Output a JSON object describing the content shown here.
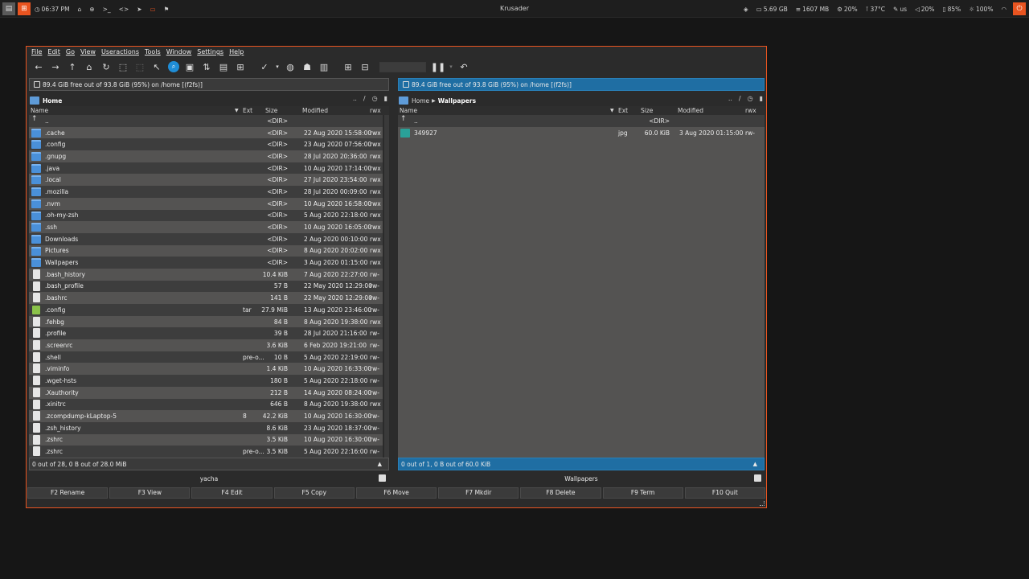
{
  "topbar": {
    "time": "06:37 PM",
    "title": "Krusader",
    "disk": "5.69 GB",
    "mem": "1607 MB",
    "cpu": "20%",
    "temp": "37°C",
    "kbd": "us",
    "volume": "20%",
    "battery": "85%",
    "brightness": "100%"
  },
  "menu": [
    "File",
    "Edit",
    "Go",
    "View",
    "Useractions",
    "Tools",
    "Window",
    "Settings",
    "Help"
  ],
  "left": {
    "info": "89.4 GiB free out of 93.8 GiB (95%) on /home [(f2fs)]",
    "path": {
      "folder": "Home",
      "crumbs": []
    },
    "controls": [
      "..",
      "/"
    ],
    "headers": {
      "name": "Name",
      "ext": "Ext",
      "size": "Size",
      "modified": "Modified",
      "perm": "rwx"
    },
    "rows": [
      {
        "icon": "up",
        "name": "..",
        "ext": "",
        "size": "<DIR>",
        "modified": "",
        "perm": ""
      },
      {
        "icon": "dir",
        "name": ".cache",
        "ext": "",
        "size": "<DIR>",
        "modified": "22 Aug 2020 15:58:00",
        "perm": "rwx"
      },
      {
        "icon": "dir",
        "name": ".config",
        "ext": "",
        "size": "<DIR>",
        "modified": "23 Aug 2020 07:56:00",
        "perm": "rwx"
      },
      {
        "icon": "dir",
        "name": ".gnupg",
        "ext": "",
        "size": "<DIR>",
        "modified": "28 Jul 2020 20:36:00",
        "perm": "rwx"
      },
      {
        "icon": "dir",
        "name": ".java",
        "ext": "",
        "size": "<DIR>",
        "modified": "10 Aug 2020 17:14:00",
        "perm": "rwx"
      },
      {
        "icon": "dir",
        "name": ".local",
        "ext": "",
        "size": "<DIR>",
        "modified": "27 Jul 2020 23:54:00",
        "perm": "rwx"
      },
      {
        "icon": "dir",
        "name": ".mozilla",
        "ext": "",
        "size": "<DIR>",
        "modified": "28 Jul 2020 00:09:00",
        "perm": "rwx"
      },
      {
        "icon": "dir",
        "name": ".nvm",
        "ext": "",
        "size": "<DIR>",
        "modified": "10 Aug 2020 16:58:00",
        "perm": "rwx"
      },
      {
        "icon": "dir",
        "name": ".oh-my-zsh",
        "ext": "",
        "size": "<DIR>",
        "modified": "5 Aug 2020 22:18:00",
        "perm": "rwx"
      },
      {
        "icon": "dir",
        "name": ".ssh",
        "ext": "",
        "size": "<DIR>",
        "modified": "10 Aug 2020 16:05:00",
        "perm": "rwx"
      },
      {
        "icon": "dir",
        "name": "Downloads",
        "ext": "",
        "size": "<DIR>",
        "modified": "2 Aug 2020 00:10:00",
        "perm": "rwx"
      },
      {
        "icon": "dir",
        "name": "Pictures",
        "ext": "",
        "size": "<DIR>",
        "modified": "8 Aug 2020 20:02:00",
        "perm": "rwx"
      },
      {
        "icon": "dir",
        "name": "Wallpapers",
        "ext": "",
        "size": "<DIR>",
        "modified": "3 Aug 2020 01:15:00",
        "perm": "rwx"
      },
      {
        "icon": "file",
        "name": ".bash_history",
        "ext": "",
        "size": "10.4 KiB",
        "modified": "7 Aug 2020 22:27:00",
        "perm": "rw-"
      },
      {
        "icon": "file",
        "name": ".bash_profile",
        "ext": "",
        "size": "57 B",
        "modified": "22 May 2020 12:29:00",
        "perm": "rw-"
      },
      {
        "icon": "file",
        "name": ".bashrc",
        "ext": "",
        "size": "141 B",
        "modified": "22 May 2020 12:29:00",
        "perm": "rw-"
      },
      {
        "icon": "arc",
        "name": ".config",
        "ext": "tar",
        "size": "27.9 MiB",
        "modified": "13 Aug 2020 23:46:00",
        "perm": "rw-"
      },
      {
        "icon": "file",
        "name": ".fehbg",
        "ext": "",
        "size": "84 B",
        "modified": "8 Aug 2020 19:38:00",
        "perm": "rwx"
      },
      {
        "icon": "file",
        "name": ".profile",
        "ext": "",
        "size": "39 B",
        "modified": "28 Jul 2020 21:16:00",
        "perm": "rw-"
      },
      {
        "icon": "file",
        "name": ".screenrc",
        "ext": "",
        "size": "3.6 KiB",
        "modified": "6 Feb 2020 19:21:00",
        "perm": "rw-"
      },
      {
        "icon": "file",
        "name": ".shell",
        "ext": "pre-o...",
        "size": "10 B",
        "modified": "5 Aug 2020 22:19:00",
        "perm": "rw-"
      },
      {
        "icon": "file",
        "name": ".viminfo",
        "ext": "",
        "size": "1.4 KiB",
        "modified": "10 Aug 2020 16:33:00",
        "perm": "rw-"
      },
      {
        "icon": "file",
        "name": ".wget-hsts",
        "ext": "",
        "size": "180 B",
        "modified": "5 Aug 2020 22:18:00",
        "perm": "rw-"
      },
      {
        "icon": "file",
        "name": ".Xauthority",
        "ext": "",
        "size": "212 B",
        "modified": "14 Aug 2020 08:24:00",
        "perm": "rw-"
      },
      {
        "icon": "file",
        "name": ".xinitrc",
        "ext": "",
        "size": "646 B",
        "modified": "8 Aug 2020 19:38:00",
        "perm": "rwx"
      },
      {
        "icon": "file",
        "name": ".zcompdump-kLaptop-5",
        "ext": "8",
        "size": "42.2 KiB",
        "modified": "10 Aug 2020 16:30:00",
        "perm": "rw-"
      },
      {
        "icon": "file",
        "name": ".zsh_history",
        "ext": "",
        "size": "8.6 KiB",
        "modified": "23 Aug 2020 18:37:00",
        "perm": "rw-"
      },
      {
        "icon": "file",
        "name": ".zshrc",
        "ext": "",
        "size": "3.5 KiB",
        "modified": "10 Aug 2020 16:30:00",
        "perm": "rw-"
      },
      {
        "icon": "file",
        "name": ".zshrc",
        "ext": "pre-o...",
        "size": "3.5 KiB",
        "modified": "5 Aug 2020 22:16:00",
        "perm": "rw-"
      }
    ],
    "status": "0 out of 28, 0 B out of 28.0 MiB",
    "cmd": "yacha"
  },
  "right": {
    "info": "89.4 GiB free out of 93.8 GiB (95%) on /home [(f2fs)]",
    "path": {
      "folder": "Wallpapers",
      "crumbs": [
        "Home"
      ]
    },
    "controls": [
      "..",
      "/"
    ],
    "headers": {
      "name": "Name",
      "ext": "Ext",
      "size": "Size",
      "modified": "Modified",
      "perm": "rwx"
    },
    "rows": [
      {
        "icon": "up",
        "name": "..",
        "ext": "",
        "size": "<DIR>",
        "modified": "",
        "perm": ""
      },
      {
        "icon": "img",
        "name": "349927",
        "ext": "jpg",
        "size": "60.0 KiB",
        "modified": "3 Aug 2020 01:15:00",
        "perm": "rw-"
      }
    ],
    "status": "0 out of 1, 0 B out of 60.0 KiB",
    "cmd": "Wallpapers"
  },
  "fkeys": [
    "F2 Rename",
    "F3 View",
    "F4 Edit",
    "F5 Copy",
    "F6 Move",
    "F7 Mkdir",
    "F8 Delete",
    "F9 Term",
    "F10 Quit"
  ],
  "colors": {
    "accent": "#e95420",
    "active_panel": "#1f6ea3",
    "folder": "#4a90d9"
  }
}
